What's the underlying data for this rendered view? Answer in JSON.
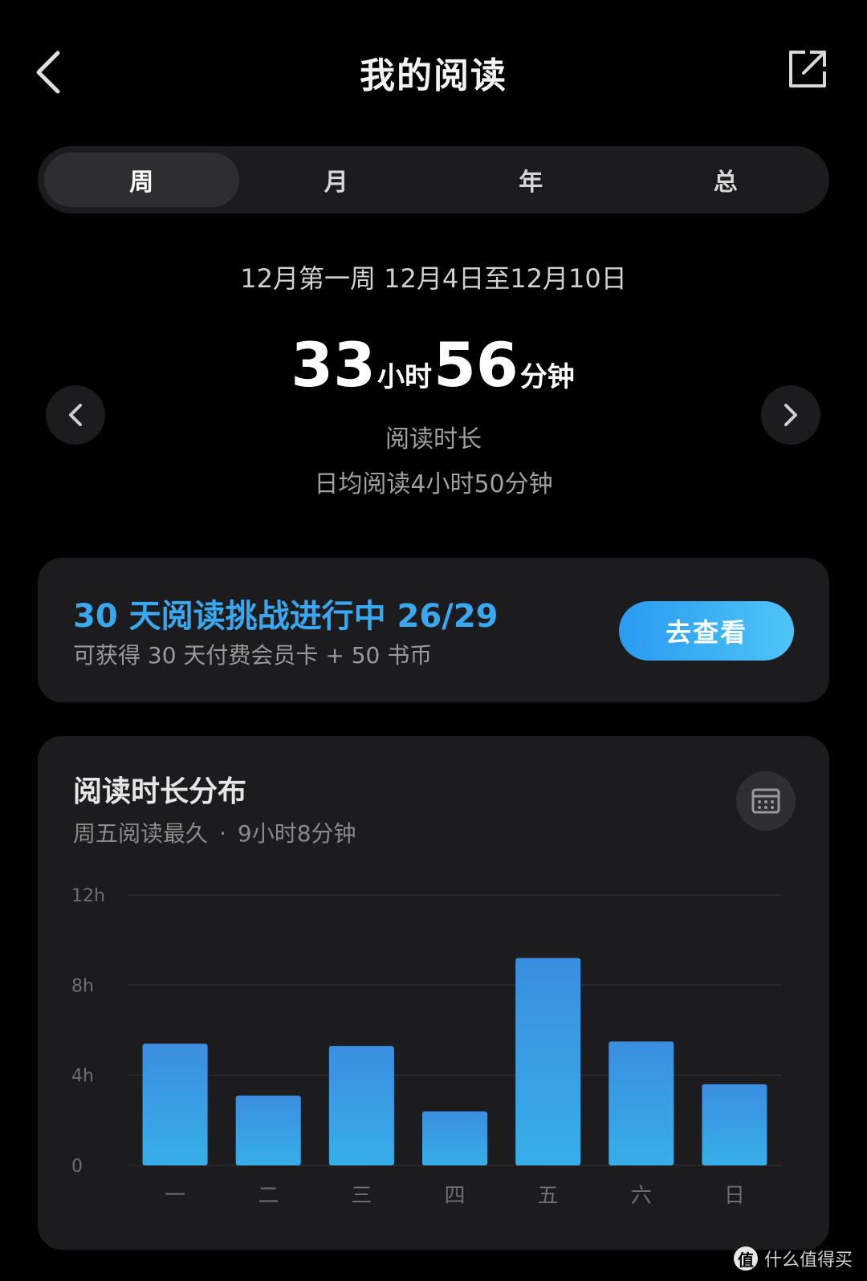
{
  "header": {
    "title": "我的阅读",
    "back_icon": "chevron-left-icon",
    "share_icon": "share-external-icon"
  },
  "tabs": [
    {
      "label": "周",
      "active": true
    },
    {
      "label": "月",
      "active": false
    },
    {
      "label": "年",
      "active": false
    },
    {
      "label": "总",
      "active": false
    }
  ],
  "summary": {
    "week_range": "12月第一周 12月4日至12月10日",
    "hours": "33",
    "hours_unit": "小时",
    "minutes": "56",
    "minutes_unit": "分钟",
    "label": "阅读时长",
    "daily_average": "日均阅读4小时50分钟"
  },
  "challenge": {
    "title": "30 天阅读挑战进行中 26/29",
    "subtitle": "可获得 30 天付费会员卡 + 50 书币",
    "button_label": "去查看"
  },
  "distribution": {
    "title": "阅读时长分布",
    "longest_day": "周五阅读最久",
    "separator": "·",
    "longest_time": "9小时8分钟"
  },
  "watermark": {
    "text": "什么值得买",
    "logo": "值"
  },
  "colors": {
    "accent": "#3aa8f0",
    "bar_top": "#3b8ee0",
    "bar_bottom": "#37aee8",
    "card_bg": "#1c1c1e"
  },
  "chart_data": {
    "type": "bar",
    "categories": [
      "一",
      "二",
      "三",
      "四",
      "五",
      "六",
      "日"
    ],
    "values": [
      5.4,
      3.1,
      5.3,
      2.4,
      9.2,
      5.5,
      3.6
    ],
    "y_ticks": [
      "0",
      "4h",
      "8h",
      "12h"
    ],
    "ylim": [
      0,
      12
    ],
    "grid": true
  }
}
